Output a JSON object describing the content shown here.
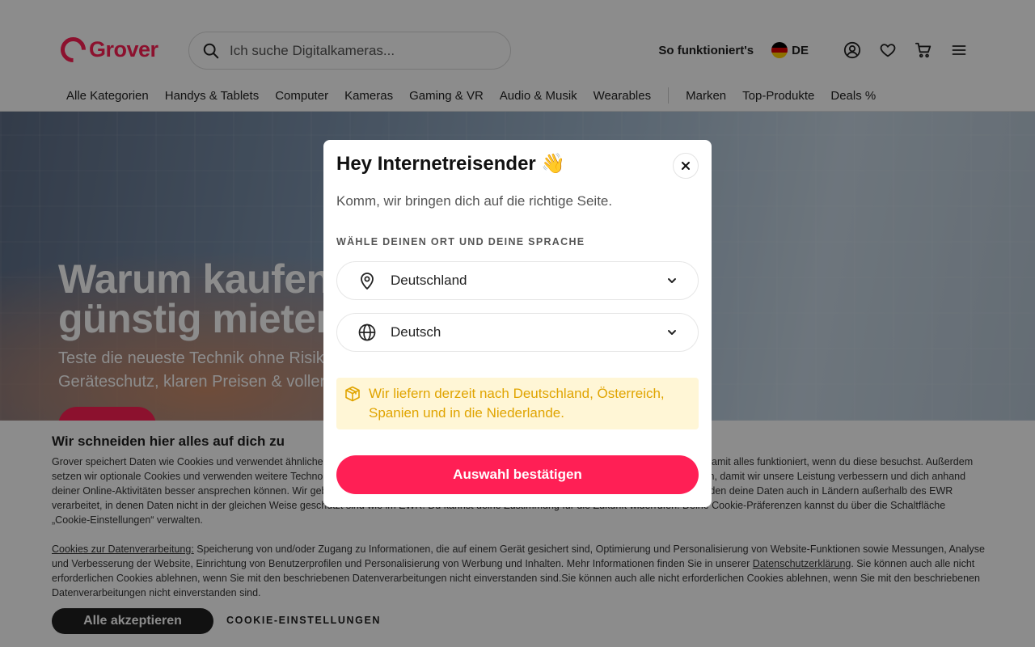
{
  "header": {
    "logo_text": "Grover",
    "search_placeholder": "Ich suche Digitalkameras...",
    "how_it_works": "So funktioniert's",
    "language_code": "DE",
    "icons": [
      "search-icon",
      "account-icon",
      "heart-icon",
      "cart-icon",
      "menu-icon"
    ]
  },
  "nav": {
    "items": [
      "Alle Kategorien",
      "Handys & Tablets",
      "Computer",
      "Kameras",
      "Gaming & VR",
      "Audio & Musik",
      "Wearables"
    ],
    "secondary": [
      "Marken",
      "Top-Produkte",
      "Deals %"
    ]
  },
  "hero": {
    "title_line1": "Warum kaufen, wenn du",
    "title_line2": "günstig mieten kannst?",
    "subtitle_line1": "Teste die neueste Technik ohne Risiko – mit",
    "subtitle_line2": "Geräteschutz, klaren Preisen & voller Flexibilität."
  },
  "cookie": {
    "title": "Wir schneiden hier alles auf dich zu",
    "text1": "Grover speichert Daten wie Cookies und verwendet ähnliche Technologien auf unserer Website und in unserer App. Einige davon sind notwendig, damit alles funktioniert, wenn du diese besuchst. Außerdem setzen wir optionale Cookies und verwenden weitere Technologien, um dein Nutzerverhalten auf unserer Website und in unserer App zu analysieren, damit wir unsere Leistung verbessern und dich anhand deiner Online-Aktivitäten besser ansprechen können. Wir geben auch Daten an Dritte weiter, die Werbung für uns schalten. In diesem Rahmen werden deine Daten auch in Ländern außerhalb des EWR verarbeitet, in denen Daten nicht in der gleichen Weise geschützt sind wie im EWR. Du kannst deine Zustimmung für die Zukunft widerrufen. Deine Cookie-Präferenzen kannst du über die Schaltfläche „Cookie-Einstellungen“ verwalten.",
    "link1": "Cookies zur Datenverarbeitung:",
    "text2": " Speicherung von und/oder Zugang zu Informationen, die auf einem Gerät gesichert sind, Optimierung und Personalisierung von Website-Funktionen sowie Messungen, Analyse und Verbesserung der Website, Einrichtung von Benutzerprofilen und Personalisierung von Werbung und Inhalten. Mehr Informationen finden Sie in unserer ",
    "link2": "Datenschutzerklärung",
    "text3": ". Sie können auch alle nicht erforderlichen Cookies ablehnen, wenn Sie mit den beschriebenen Datenverarbeitungen nicht einverstanden sind.Sie können auch alle nicht erforderlichen Cookies ablehnen, wenn Sie mit den beschriebenen Datenverarbeitungen nicht einverstanden sind.",
    "accept_label": "Alle akzeptieren",
    "settings_label": "COOKIE-EINSTELLUNGEN"
  },
  "modal": {
    "title": "Hey Internetreisender 👋",
    "subtitle": "Komm, wir bringen dich auf die richtige Seite.",
    "section_label": "WÄHLE DEINEN ORT UND DEINE SPRACHE",
    "country_value": "Deutschland",
    "language_value": "Deutsch",
    "notice": "Wir liefern derzeit nach Deutschland, Österreich, Spanien und in die Niederlande.",
    "confirm_label": "Auswahl bestätigen",
    "colors": {
      "accent": "#ff1f55",
      "notice_bg": "#fff6d6",
      "notice_text": "#e0a400"
    }
  }
}
